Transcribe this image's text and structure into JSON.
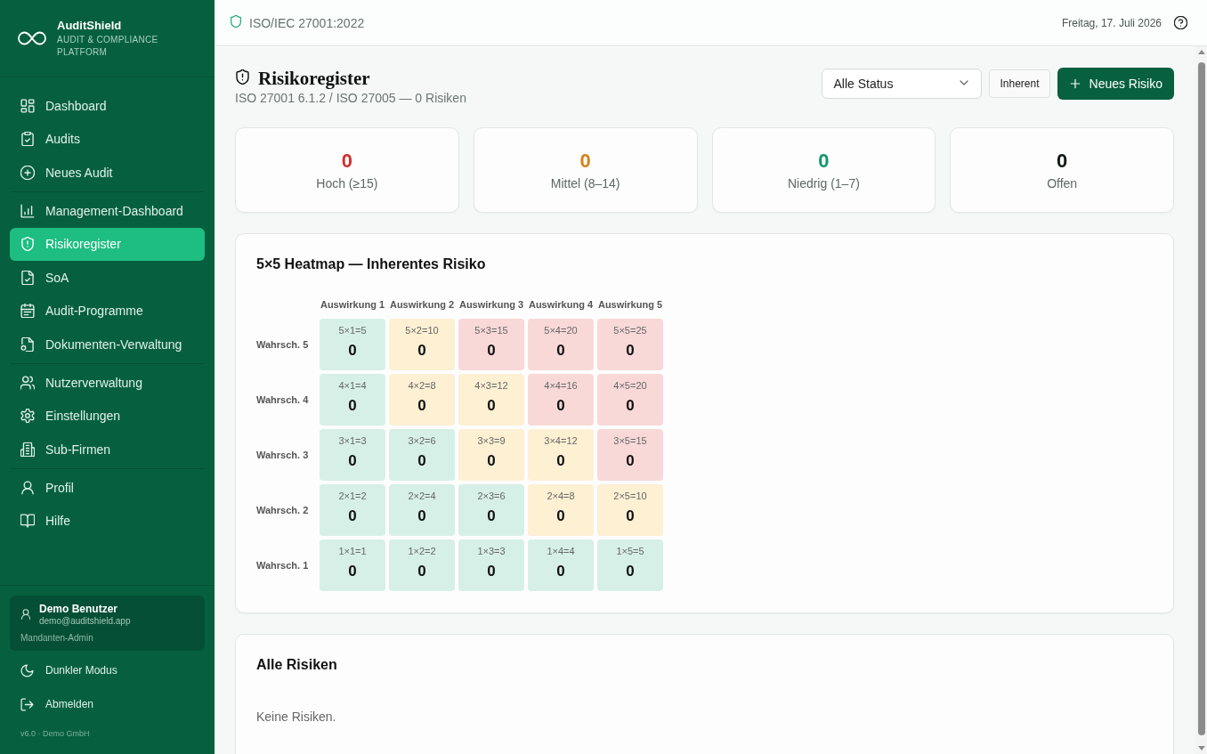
{
  "sidebar": {
    "brand": {
      "name": "AuditShield",
      "tagline": "AUDIT & COMPLIANCE PLATFORM"
    },
    "sections": [
      {
        "items": [
          {
            "label": "Dashboard",
            "selected": false
          },
          {
            "label": "Audits",
            "selected": false
          },
          {
            "label": "Neues Audit",
            "selected": false
          }
        ]
      },
      {
        "items": [
          {
            "label": "Management-Dashboard",
            "selected": false
          },
          {
            "label": "Risikoregister",
            "selected": true
          },
          {
            "label": "SoA",
            "selected": false
          },
          {
            "label": "Audit-Programme",
            "selected": false
          },
          {
            "label": "Dokumenten-Verwaltung",
            "selected": false
          }
        ]
      },
      {
        "items": [
          {
            "label": "Nutzerverwaltung",
            "selected": false
          },
          {
            "label": "Einstellungen",
            "selected": false
          },
          {
            "label": "Sub-Firmen",
            "selected": false
          }
        ]
      },
      {
        "items": [
          {
            "label": "Profil",
            "selected": false
          },
          {
            "label": "Hilfe",
            "selected": false
          }
        ]
      }
    ],
    "user": {
      "name": "Demo Benutzer",
      "email": "demo@auditshield.app",
      "role": "Mandanten-Admin"
    },
    "actions": [
      {
        "label": "Dunkler Modus"
      },
      {
        "label": "Abmelden"
      }
    ],
    "footer": "v6.0 · Demo GmbH"
  },
  "header": {
    "standard": "ISO/IEC 27001:2022",
    "date": "Freitag, 17. Juli 2026"
  },
  "page": {
    "title": "Risikoregister",
    "subtitle": "ISO 27001 6.1.2 / ISO 27005 — 0 Risiken",
    "status_filter": {
      "value": "Alle Status"
    },
    "mode_button": "Inherent",
    "new_button": "Neues Risiko"
  },
  "stats": [
    {
      "value": "0",
      "label": "Hoch (≥15)",
      "color": "#d0302c"
    },
    {
      "value": "0",
      "label": "Mittel (8–14)",
      "color": "#d4821c"
    },
    {
      "value": "0",
      "label": "Niedrig (1–7)",
      "color": "#139669"
    },
    {
      "value": "0",
      "label": "Offen",
      "color": "#0f1a14"
    }
  ],
  "heatmap": {
    "title": "5×5 Heatmap — Inherentes Risiko",
    "columns": [
      "Auswirkung 1",
      "Auswirkung 2",
      "Auswirkung 3",
      "Auswirkung 4",
      "Auswirkung 5"
    ],
    "rows": [
      {
        "label": "Wahrsch. 5",
        "cells": [
          {
            "formula": "5×1=5",
            "count": "0",
            "color": "#d6f0e8"
          },
          {
            "formula": "5×2=10",
            "count": "0",
            "color": "#fdf0d3"
          },
          {
            "formula": "5×3=15",
            "count": "0",
            "color": "#f9d8d8"
          },
          {
            "formula": "5×4=20",
            "count": "0",
            "color": "#f9d8d8"
          },
          {
            "formula": "5×5=25",
            "count": "0",
            "color": "#f9d8d8"
          }
        ]
      },
      {
        "label": "Wahrsch. 4",
        "cells": [
          {
            "formula": "4×1=4",
            "count": "0",
            "color": "#d6f0e8"
          },
          {
            "formula": "4×2=8",
            "count": "0",
            "color": "#fdf0d3"
          },
          {
            "formula": "4×3=12",
            "count": "0",
            "color": "#fdf0d3"
          },
          {
            "formula": "4×4=16",
            "count": "0",
            "color": "#f9d8d8"
          },
          {
            "formula": "4×5=20",
            "count": "0",
            "color": "#f9d8d8"
          }
        ]
      },
      {
        "label": "Wahrsch. 3",
        "cells": [
          {
            "formula": "3×1=3",
            "count": "0",
            "color": "#d6f0e8"
          },
          {
            "formula": "3×2=6",
            "count": "0",
            "color": "#d6f0e8"
          },
          {
            "formula": "3×3=9",
            "count": "0",
            "color": "#fdf0d3"
          },
          {
            "formula": "3×4=12",
            "count": "0",
            "color": "#fdf0d3"
          },
          {
            "formula": "3×5=15",
            "count": "0",
            "color": "#f9d8d8"
          }
        ]
      },
      {
        "label": "Wahrsch. 2",
        "cells": [
          {
            "formula": "2×1=2",
            "count": "0",
            "color": "#d6f0e8"
          },
          {
            "formula": "2×2=4",
            "count": "0",
            "color": "#d6f0e8"
          },
          {
            "formula": "2×3=6",
            "count": "0",
            "color": "#d6f0e8"
          },
          {
            "formula": "2×4=8",
            "count": "0",
            "color": "#fdf0d3"
          },
          {
            "formula": "2×5=10",
            "count": "0",
            "color": "#fdf0d3"
          }
        ]
      },
      {
        "label": "Wahrsch. 1",
        "cells": [
          {
            "formula": "1×1=1",
            "count": "0",
            "color": "#d6f0e8"
          },
          {
            "formula": "1×2=2",
            "count": "0",
            "color": "#d6f0e8"
          },
          {
            "formula": "1×3=3",
            "count": "0",
            "color": "#d6f0e8"
          },
          {
            "formula": "1×4=4",
            "count": "0",
            "color": "#d6f0e8"
          },
          {
            "formula": "1×5=5",
            "count": "0",
            "color": "#d6f0e8"
          }
        ]
      }
    ]
  },
  "risks": {
    "title": "Alle Risiken",
    "empty_text": "Keine Risiken."
  }
}
